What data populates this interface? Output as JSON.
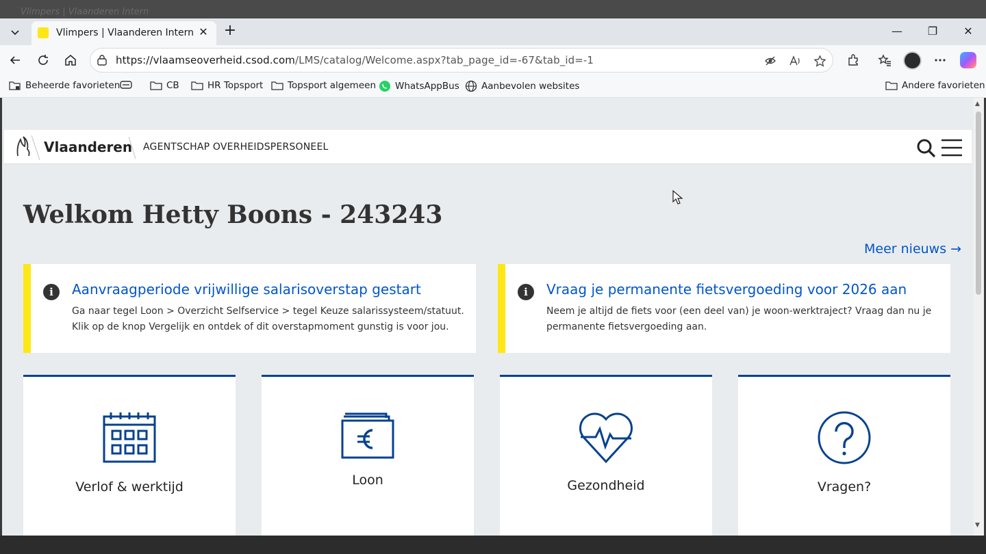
{
  "browser": {
    "background_tab_title": "Vlimpers | Vlaanderen Intern",
    "tab_title": "Vlimpers | Vlaanderen Intern",
    "url_host": "https://vlaamseoverheid.csod.com",
    "url_path": "/LMS/catalog/Welcome.aspx?tab_page_id=-67&tab_id=-1",
    "favorites": [
      {
        "label": "Beheerde favorieten",
        "icon": "managed-folder-icon"
      },
      {
        "label": "",
        "icon": "link-icon"
      },
      {
        "label": "CB",
        "icon": "folder-icon"
      },
      {
        "label": "HR Topsport",
        "icon": "folder-icon"
      },
      {
        "label": "Topsport algemeen",
        "icon": "folder-icon"
      },
      {
        "label": "WhatsAppBus",
        "icon": "whatsapp-icon"
      },
      {
        "label": "Aanbevolen websites",
        "icon": "globe-icon"
      }
    ],
    "other_favorites": "Andere favorieten"
  },
  "site": {
    "logo_text": "Vlaanderen",
    "agency": "AGENTSCHAP OVERHEIDSPERSONEEL",
    "welcome": "Welkom Hetty Boons - 243243",
    "more_news": "Meer nieuws →",
    "news": [
      {
        "title": "Aanvraagperiode vrijwillige salarisoverstap gestart",
        "body": "Ga naar tegel Loon > Overzicht Selfservice > tegel Keuze salarissysteem/statuut. Klik op de knop Vergelijk en ontdek of dit overstapmoment gunstig is voor jou."
      },
      {
        "title": "Vraag je permanente fietsvergoeding voor 2026 aan",
        "body": "Neem je altijd de fiets voor (een deel van) je woon-werktraject? Vraag dan nu je permanente fietsvergoeding aan."
      }
    ],
    "tiles": [
      {
        "label": "Verlof & werktijd",
        "icon": "calendar-icon"
      },
      {
        "label": "Loon",
        "icon": "euro-wallet-icon"
      },
      {
        "label": "Gezondheid",
        "icon": "heart-pulse-icon"
      },
      {
        "label": "Vragen?",
        "icon": "question-icon"
      }
    ]
  },
  "colors": {
    "accent_blue": "#0055cc",
    "tile_border": "#05418f",
    "news_stripe": "#ffe615"
  }
}
